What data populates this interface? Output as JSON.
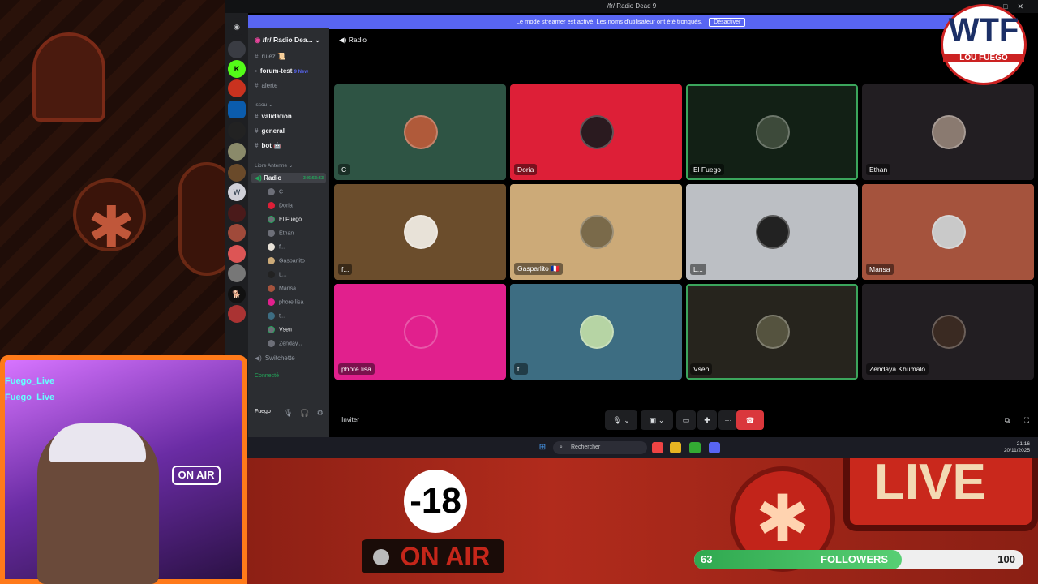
{
  "window": {
    "title": "/fr/ Radio Dead 9"
  },
  "streamer_banner": {
    "text": "Le mode streamer est activé. Les noms d'utilisateur ont été tronqués.",
    "button": "Désactiver"
  },
  "server": {
    "name": "/fr/ Radio Dea..."
  },
  "channels": [
    {
      "label": "rulez 📜",
      "type": "text",
      "bold": false
    },
    {
      "label": "forum-test",
      "type": "forum",
      "bold": true,
      "badge": "9 New"
    },
    {
      "label": "alerte",
      "type": "text",
      "bold": false
    },
    {
      "label": "issou",
      "type": "category"
    },
    {
      "label": "validation",
      "type": "text",
      "bold": true
    },
    {
      "label": "general",
      "type": "text",
      "bold": true
    },
    {
      "label": "bot 🤖",
      "type": "text",
      "bold": true
    },
    {
      "label": "Libre Antenne",
      "type": "category"
    },
    {
      "label": "Radio",
      "type": "voice",
      "bold": true,
      "timer": "346:53:53"
    }
  ],
  "voice_users": [
    "C",
    "Doria",
    "El Fuego",
    "Ethan",
    "f...",
    "Gasparlito",
    "L...",
    "Mansa",
    "phore lisa",
    "t...",
    "Vsen",
    "Zenday..."
  ],
  "voice_footer": {
    "channel": "Switchette",
    "status": "Connecté"
  },
  "user_panel": {
    "name": "Fuego"
  },
  "header": {
    "channel": "Radio",
    "invite": "Inviter"
  },
  "tiles": [
    {
      "name": "C",
      "color": "#2e5444",
      "avatar": "#b05a3a",
      "speaking": false
    },
    {
      "name": "Doria",
      "color": "#dd1f37",
      "avatar": "#2a1a1f",
      "speaking": false
    },
    {
      "name": "El Fuego",
      "color": "#122015",
      "avatar": "#3d4a3a",
      "speaking": true
    },
    {
      "name": "Ethan",
      "color": "#221e22",
      "avatar": "#8a7a70",
      "speaking": false
    },
    {
      "name": "f...",
      "color": "#6b4d2c",
      "avatar": "#e8e2d8",
      "speaking": false
    },
    {
      "name": "Gasparlito 🇫🇷",
      "color": "#ccaa78",
      "avatar": "#7a6a4a",
      "speaking": false
    },
    {
      "name": "L...",
      "color": "#bcbfc4",
      "avatar": "#222",
      "speaking": false
    },
    {
      "name": "Mansa",
      "color": "#a5533d",
      "avatar": "#c9c9c9",
      "speaking": false
    },
    {
      "name": "phore lisa",
      "color": "#e1208d",
      "avatar": "#e1208d",
      "speaking": false
    },
    {
      "name": "t...",
      "color": "#3d6d82",
      "avatar": "#b6d4a4",
      "speaking": false
    },
    {
      "name": "Vsen",
      "color": "#26241d",
      "avatar": "#55533f",
      "speaking": true
    },
    {
      "name": "Zendaya Khumalo",
      "color": "#221e22",
      "avatar": "#3a2a22",
      "speaking": false
    }
  ],
  "taskbar": {
    "search": "Rechercher",
    "time": "21:16",
    "date": "20/11/2025"
  },
  "overlay": {
    "chat_lines": [
      "Fuego_Live",
      "Fuego_Live"
    ],
    "age": "-18",
    "onair": "ON AIR",
    "live": "LIVE",
    "logo": "WTF",
    "logo_sub": "LOU FUEGO",
    "followers": {
      "label": "FOLLOWERS",
      "current": "63",
      "goal": "100",
      "progress": 0.63
    }
  }
}
